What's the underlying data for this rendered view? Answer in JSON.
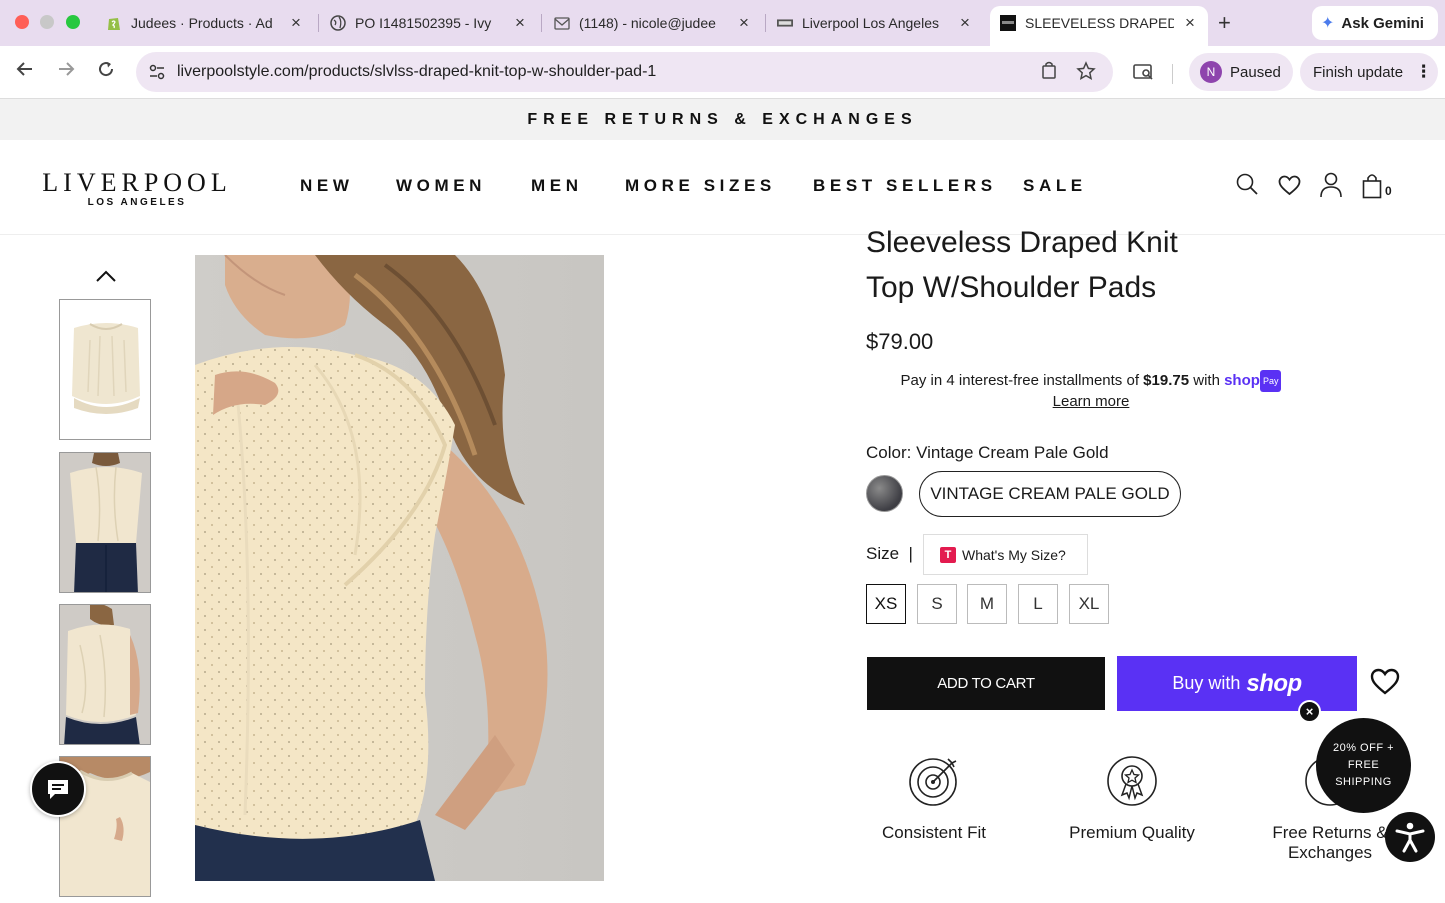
{
  "browser": {
    "tabs": [
      {
        "title": "Judees · Products · Ad",
        "icon": "shopify-icon"
      },
      {
        "title": "PO I1481502395 - Ivy",
        "icon": "globe-icon"
      },
      {
        "title": "(1148) - nicole@judee",
        "icon": "mail-icon"
      },
      {
        "title": "Liverpool Los Angeles",
        "icon": "store-icon"
      },
      {
        "title": "SLEEVELESS DRAPED",
        "icon": "store-icon"
      }
    ],
    "ask_gemini": "Ask Gemini",
    "url": "liverpoolstyle.com/products/slvlss-draped-knit-top-w-shoulder-pad-1",
    "profile_initial": "N",
    "profile_status": "Paused",
    "finish_update": "Finish update"
  },
  "site": {
    "promo_banner": "FREE RETURNS & EXCHANGES",
    "logo_main": "LIVERPOOL",
    "logo_sub": "LOS ANGELES",
    "nav": [
      "NEW",
      "WOMEN",
      "MEN",
      "MORE SIZES",
      "BEST SELLERS",
      "SALE"
    ],
    "cart_count": "0"
  },
  "product": {
    "title_line1": "Sleeveless Draped Knit",
    "title_line2": "Top W/Shoulder Pads",
    "price": "$79.00",
    "installments_prefix": "Pay in 4 interest-free installments of",
    "installment_amount": "$19.75",
    "installments_with": "with",
    "shop_brand": "shop",
    "pay_badge": "Pay",
    "learn_more": "Learn more",
    "color_label": "Color: Vintage Cream Pale Gold",
    "color_option": "VINTAGE CREAM PALE GOLD",
    "size_label": "Size",
    "size_separator": "|",
    "whats_my_size": "What's My Size?",
    "sizes": [
      "XS",
      "S",
      "M",
      "L",
      "XL"
    ],
    "selected_size": "XS",
    "add_to_cart": "ADD TO CART",
    "buy_with": "Buy with",
    "buy_shop": "shop",
    "features": [
      "Consistent Fit",
      "Premium Quality",
      "Free Returns & Exchanges"
    ]
  },
  "floating": {
    "promo_text": [
      "20% OFF +",
      "FREE",
      "SHIPPING"
    ],
    "close": "×"
  },
  "colors": {
    "shop_purple": "#5a31f4",
    "chrome_tab_bg": "#e8dcef"
  }
}
